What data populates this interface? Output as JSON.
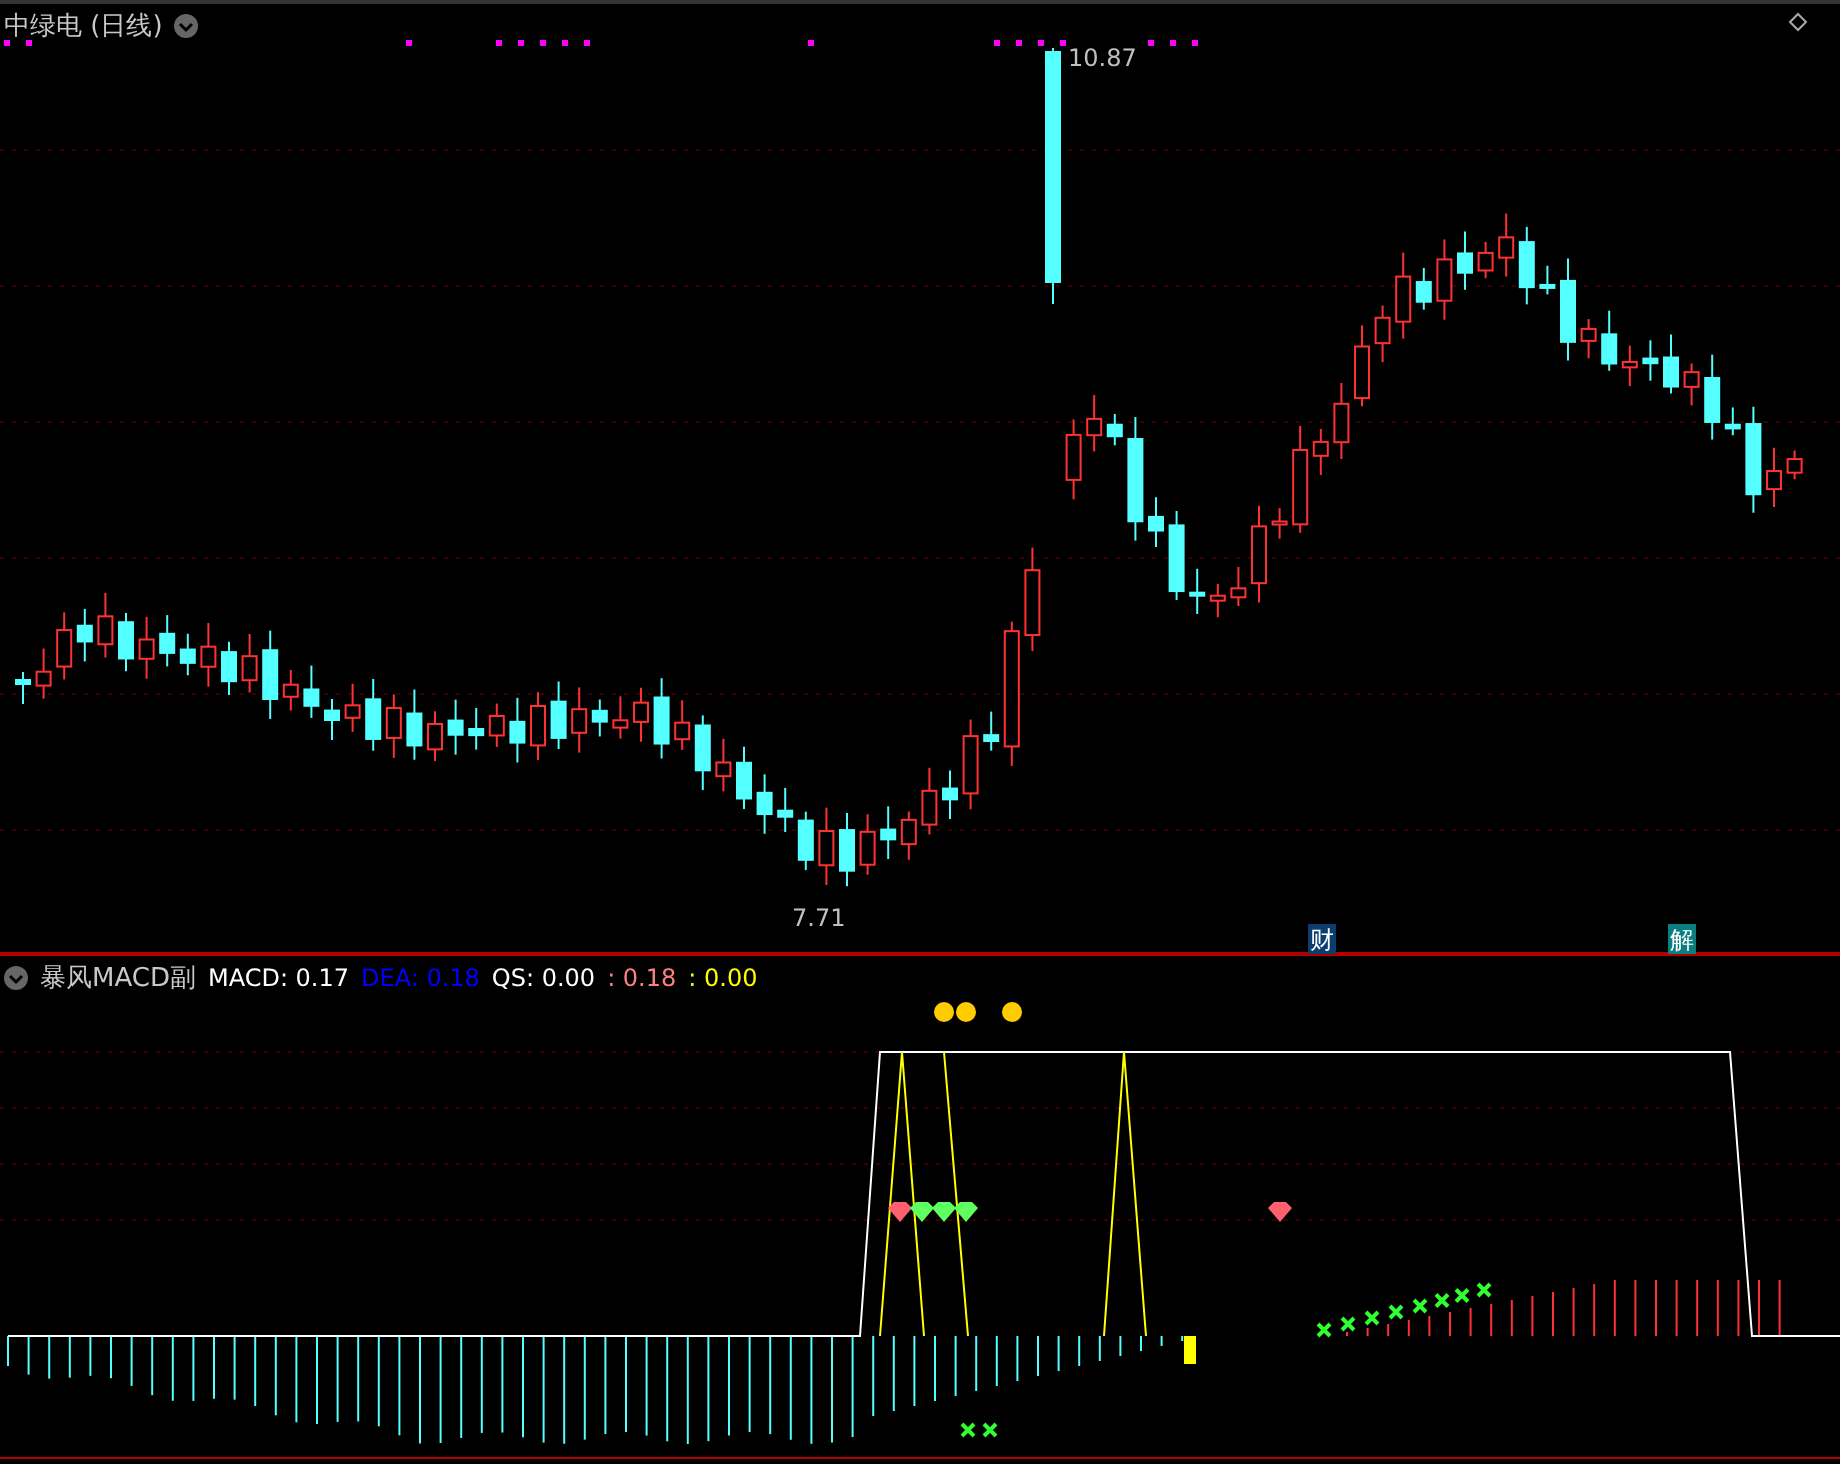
{
  "main_chart": {
    "title": "中绿电 (日线)",
    "high_label": "10.87",
    "low_label": "7.71",
    "event_badges": [
      {
        "text": "财",
        "color": "#0b3d6e"
      },
      {
        "text": "解",
        "color": "#0b7f80"
      }
    ]
  },
  "indicator": {
    "title": "暴风MACD副",
    "values": [
      {
        "label": "MACD: 0.17",
        "color": "#ffffff"
      },
      {
        "label": "DEA: 0.18",
        "color": "#0000ff"
      },
      {
        "label": "QS: 0.00",
        "color": "#ffffff"
      },
      {
        "label": ": 0.18",
        "color": "#ff8080"
      },
      {
        "label": ": 0.00",
        "color": "#ffff00"
      }
    ]
  }
}
